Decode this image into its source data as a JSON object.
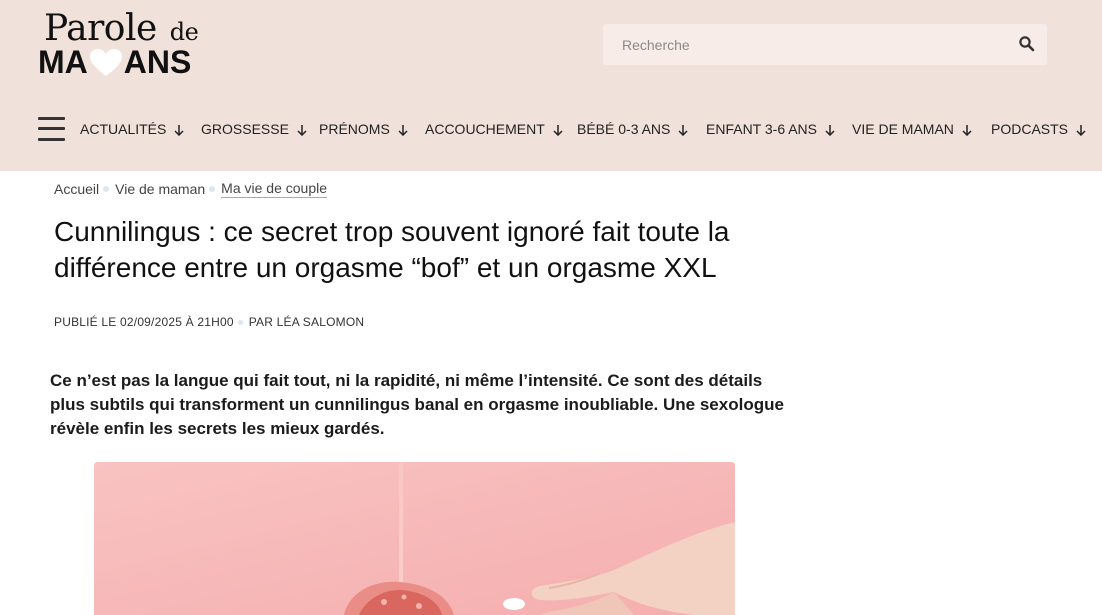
{
  "header": {
    "logo": {
      "line1": "Parole",
      "line1_small": "de",
      "line2_a": "MA",
      "line2_b": "ANS"
    },
    "search": {
      "placeholder": "Recherche"
    },
    "nav": [
      {
        "label": "ACTUALITÉS"
      },
      {
        "label": "GROSSESSE"
      },
      {
        "label": "PRÉNOMS"
      },
      {
        "label": "ACCOUCHEMENT"
      },
      {
        "label": "BÉBÉ 0-3 ANS"
      },
      {
        "label": "ENFANT 3-6 ANS"
      },
      {
        "label": "VIE DE MAMAN"
      },
      {
        "label": "PODCASTS"
      }
    ]
  },
  "breadcrumb": [
    "Accueil",
    "Vie de maman",
    "Ma vie de couple"
  ],
  "article": {
    "title": "Cunnilingus : ce secret trop souvent ignoré fait toute la différence entre un orgasme “bof” et un orgasme XXL",
    "published": "PUBLIÉ LE 02/09/2025 À 21H00",
    "author": "PAR LÉA SALOMON",
    "intro": "Ce n’est pas la langue qui fait tout, ni la rapidité, ni même l’intensité. Ce sont des détails plus subtils qui transforment un cunnilingus banal en orgasme inoubliable. Une sexologue révèle enfin les secrets les mieux gardés."
  },
  "icons": {
    "logo_heart": "heart-icon",
    "search": "search-icon",
    "menu": "hamburger-menu-icon",
    "nav_arrow": "arrow-down-icon"
  },
  "colors": {
    "header_bg": "#f0e1da",
    "search_bg": "#f7ece7",
    "hero_bg": "#f7b9b8",
    "separator_dot": "#dbe7ef"
  }
}
